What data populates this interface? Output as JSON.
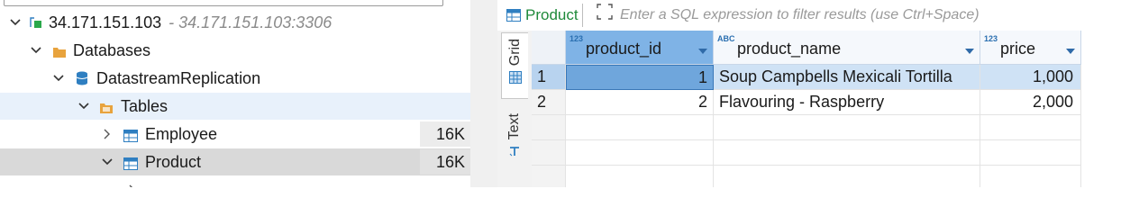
{
  "navigator": {
    "connection": {
      "label": "34.171.151.103",
      "detail": "- 34.171.151.103:3306"
    },
    "databases_label": "Databases",
    "database_label": "DatastreamReplication",
    "tables_label": "Tables",
    "tables": [
      {
        "label": "Employee",
        "size": "16K"
      },
      {
        "label": "Product",
        "size": "16K"
      }
    ]
  },
  "editor": {
    "table_tab_label": "Product",
    "filter_placeholder": "Enter a SQL expression to filter results (use Ctrl+Space)",
    "view_tabs": {
      "grid": "Grid",
      "text": "Text"
    },
    "columns": [
      {
        "name": "product_id",
        "type": "123"
      },
      {
        "name": "product_name",
        "type": "ABC"
      },
      {
        "name": "price",
        "type": "123"
      }
    ],
    "rows": [
      {
        "num": "1",
        "product_id": "1",
        "product_name": "Soup Campbells Mexicali Tortilla",
        "price": "1,000"
      },
      {
        "num": "2",
        "product_id": "2",
        "product_name": "Flavouring - Raspberry",
        "price": "2,000"
      }
    ]
  },
  "colors": {
    "selected_header": "#7fb3e6",
    "selected_cell": "#6fa6dc",
    "table_tab_green": "#1f8a3a",
    "folder_orange": "#e8a33d",
    "table_blue": "#2f7fc1"
  }
}
